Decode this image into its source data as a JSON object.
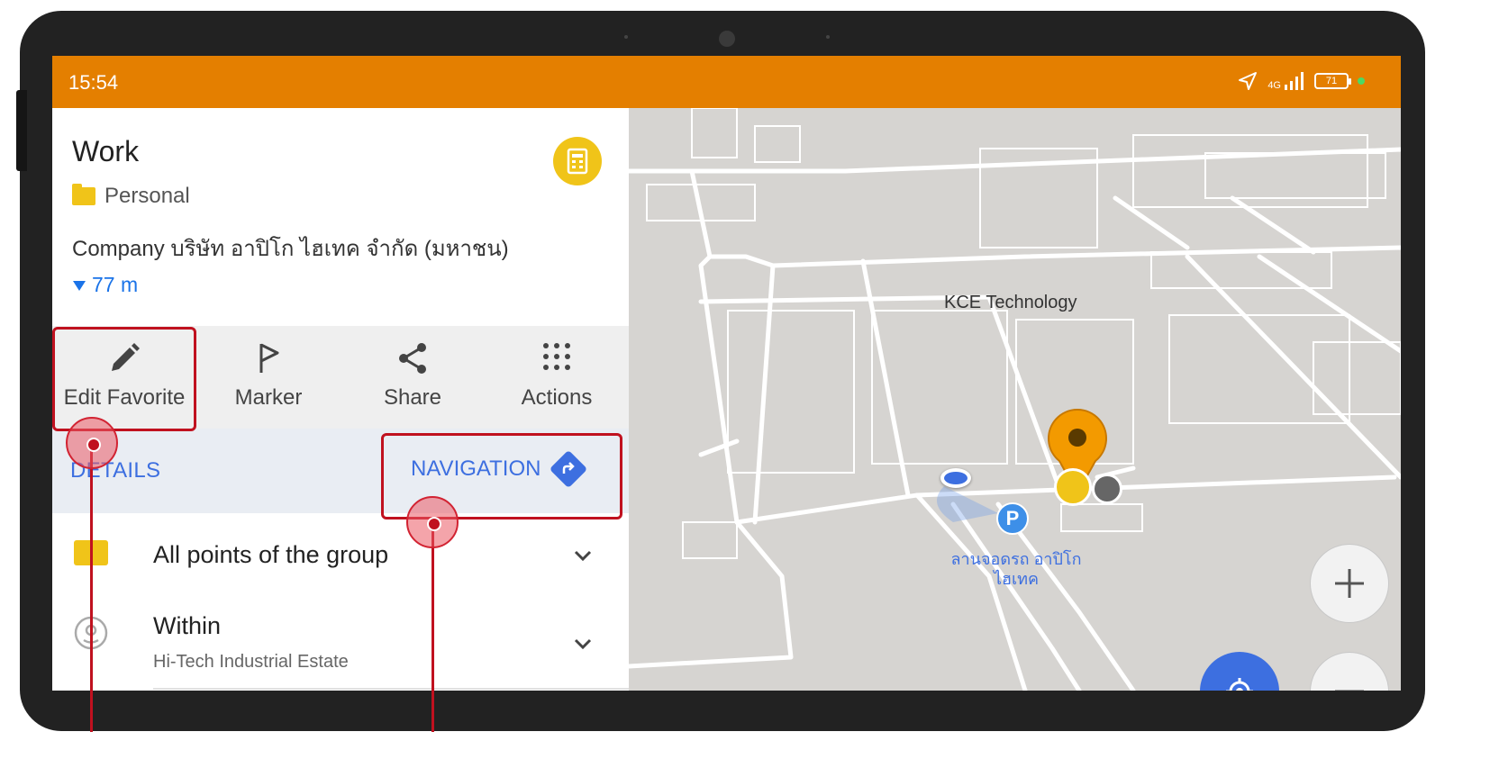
{
  "status_bar": {
    "time": "15:54",
    "network": "4G",
    "battery": "71"
  },
  "place": {
    "title": "Work",
    "group": "Personal",
    "description": "Company บริษัท อาปิโก ไฮเทค จำกัด (มหาชน)",
    "distance": "77 m"
  },
  "actions": [
    {
      "label": "Edit Favorite",
      "icon": "pencil-icon"
    },
    {
      "label": "Marker",
      "icon": "flag-icon"
    },
    {
      "label": "Share",
      "icon": "share-icon"
    },
    {
      "label": "Actions",
      "icon": "grid-dots-icon"
    }
  ],
  "nav": {
    "details": "DETAILS",
    "navigation": "NAVIGATION"
  },
  "list": [
    {
      "title": "All points of the group",
      "subtitle": "",
      "icon": "folder-icon"
    },
    {
      "title": "Within",
      "subtitle": "Hi-Tech Industrial Estate",
      "icon": "location-circle-icon"
    }
  ],
  "map": {
    "label_building": "KCE Technology",
    "label_parking": "ลานจอดรถ อาปิโก ไฮเทค",
    "parking_letter": "P"
  },
  "colors": {
    "status_bar": "#e47f00",
    "accent_blue": "#3d6fe0",
    "favorite_yellow": "#f0c419",
    "marker_orange": "#f39a00",
    "callout_red": "#c0111f"
  }
}
